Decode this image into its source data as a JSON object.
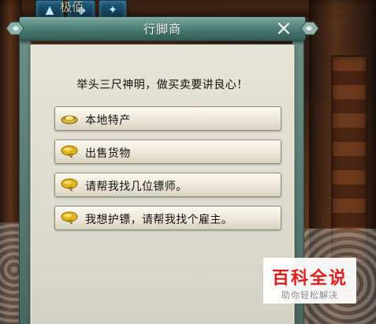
{
  "dialog": {
    "title": "行脚商",
    "message": "举头三尺神明，做买卖要讲良心！"
  },
  "options": [
    {
      "label": "本地特产",
      "icon": "gold-ingot-icon"
    },
    {
      "label": "出售货物",
      "icon": "speech-bubble-icon"
    },
    {
      "label": "请帮我找几位镖师。",
      "icon": "speech-bubble-icon"
    },
    {
      "label": "我想护镖，请帮我找个雇主。",
      "icon": "speech-bubble-icon"
    }
  ],
  "hud": {
    "icons": [
      "hud-slot-1",
      "hud-slot-2",
      "hud-slot-3"
    ],
    "text": "极佰"
  },
  "watermark": {
    "main": "百科全说",
    "sub": "助你轻松解决"
  },
  "colors": {
    "title_bar": "#4a7b71",
    "panel_bg": "#dfddd1",
    "button_bg": "#f1ecdf",
    "text_dark": "#141414",
    "watermark_red": "#e21d1d"
  }
}
